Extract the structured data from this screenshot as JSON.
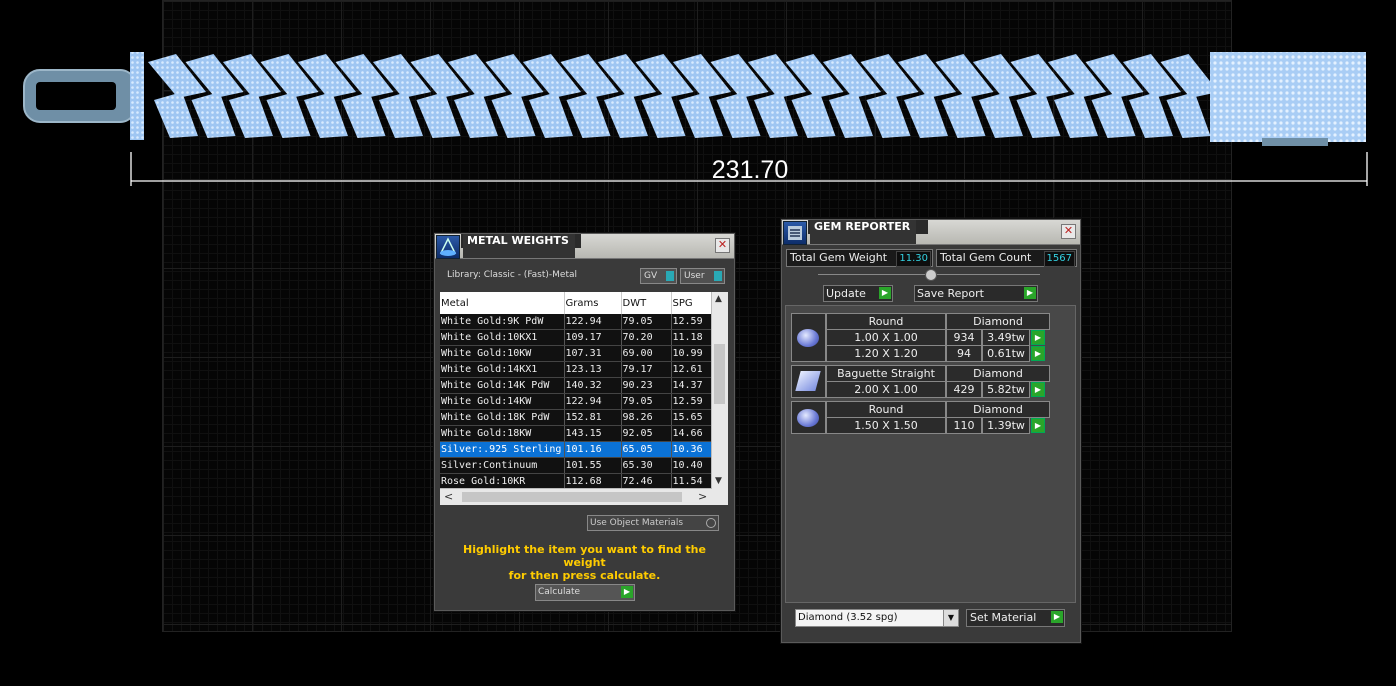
{
  "viewport": {
    "dimension": "231.70"
  },
  "metal_weights": {
    "title": "METAL WEIGHTS",
    "library": "Library: Classic - (Fast)-Metal",
    "toggle_gv": "GV",
    "toggle_user": "User",
    "columns": [
      "Metal",
      "Grams",
      "DWT",
      "SPG"
    ],
    "rows": [
      [
        "White Gold:9K PdW",
        "122.94",
        "79.05",
        "12.59"
      ],
      [
        "White Gold:10KX1",
        "109.17",
        "70.20",
        "11.18"
      ],
      [
        "White Gold:10KW",
        "107.31",
        "69.00",
        "10.99"
      ],
      [
        "White Gold:14KX1",
        "123.13",
        "79.17",
        "12.61"
      ],
      [
        "White Gold:14K PdW",
        "140.32",
        "90.23",
        "14.37"
      ],
      [
        "White Gold:14KW",
        "122.94",
        "79.05",
        "12.59"
      ],
      [
        "White Gold:18K PdW",
        "152.81",
        "98.26",
        "15.65"
      ],
      [
        "White Gold:18KW",
        "143.15",
        "92.05",
        "14.66"
      ],
      [
        "Silver:.925 Sterling",
        "101.16",
        "65.05",
        "10.36"
      ],
      [
        "Silver:Continuum",
        "101.55",
        "65.30",
        "10.40"
      ],
      [
        "Rose Gold:10KR",
        "112.68",
        "72.46",
        "11.54"
      ]
    ],
    "selected_row": 8,
    "use_object_materials": "Use Object Materials",
    "hint_line1": "Highlight the item you want to find the weight",
    "hint_line2": "for then press calculate.",
    "calculate": "Calculate"
  },
  "gem_reporter": {
    "title": "GEM REPORTER",
    "total_weight_label": "Total Gem Weight",
    "total_weight_value": "11.30",
    "total_count_label": "Total Gem Count",
    "total_count_value": "1567",
    "update": "Update",
    "save_report": "Save Report",
    "groups": [
      {
        "shape": "Round",
        "material": "Diamond",
        "icon": "round-gem-icon",
        "sizes": [
          {
            "size": "1.00 X 1.00",
            "count": "934",
            "weight": "3.49tw"
          },
          {
            "size": "1.20 X 1.20",
            "count": "94",
            "weight": "0.61tw"
          }
        ]
      },
      {
        "shape": "Baguette Straight",
        "material": "Diamond",
        "icon": "baguette-gem-icon",
        "sizes": [
          {
            "size": "2.00 X 1.00",
            "count": "429",
            "weight": "5.82tw"
          }
        ]
      },
      {
        "shape": "Round",
        "material": "Diamond",
        "icon": "round-gem-icon",
        "sizes": [
          {
            "size": "1.50 X 1.50",
            "count": "110",
            "weight": "1.39tw"
          }
        ]
      }
    ],
    "material_select": "Diamond      (3.52 spg)",
    "set_material": "Set Material"
  },
  "colors": {
    "accent_cyan": "#33d0e0",
    "selection_blue": "#0b72d6",
    "go_green": "#2aa52a",
    "hint_yellow": "#ffcc00"
  }
}
